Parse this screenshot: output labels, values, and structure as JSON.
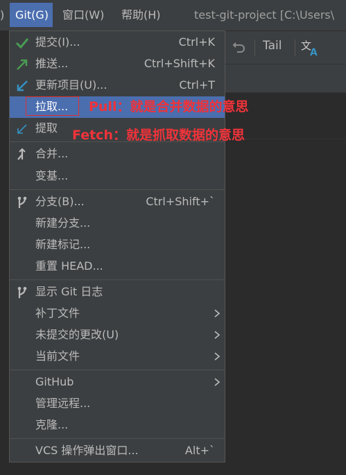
{
  "menubar": {
    "partial_paren": ")",
    "git": "Git(G)",
    "window": "窗口(W)",
    "help": "帮助(H)",
    "window_title": "test-git-project [C:\\Users\\"
  },
  "toolbar": {
    "tail_label": "Tail",
    "undo_icon": "undo-icon",
    "translate_icon": "translate-icon"
  },
  "menu": {
    "commit": {
      "label": "提交(I)...",
      "shortcut": "Ctrl+K",
      "icon": "check-icon",
      "icon_color": "#499c54"
    },
    "push": {
      "label": "推送...",
      "shortcut": "Ctrl+Shift+K",
      "icon": "push-arrow-icon",
      "icon_color": "#499c54"
    },
    "update": {
      "label": "更新项目(U)...",
      "shortcut": "Ctrl+T",
      "icon": "update-arrow-icon",
      "icon_color": "#3592c4"
    },
    "pull": {
      "label": "拉取..."
    },
    "fetch": {
      "label": "提取",
      "icon": "fetch-arrow-icon",
      "icon_color": "#3592c4"
    },
    "merge": {
      "label": "合并...",
      "icon": "merge-icon"
    },
    "rebase": {
      "label": "变基..."
    },
    "branches": {
      "label": "分支(B)...",
      "shortcut": "Ctrl+Shift+`",
      "icon": "branch-icon"
    },
    "new_branch": {
      "label": "新建分支..."
    },
    "new_tag": {
      "label": "新建标记..."
    },
    "reset_head": {
      "label": "重置 HEAD..."
    },
    "show_log": {
      "label": "显示 Git 日志",
      "icon": "git-log-icon"
    },
    "patch": {
      "label": "补丁文件"
    },
    "uncommitted": {
      "label": "未提交的更改(U)"
    },
    "current_file": {
      "label": "当前文件"
    },
    "github": {
      "label": "GitHub"
    },
    "manage_remotes": {
      "label": "管理远程..."
    },
    "clone": {
      "label": "克隆..."
    },
    "vcs_popup": {
      "label": "VCS 操作弹出窗口...",
      "shortcut": "Alt+`"
    }
  },
  "annotations": {
    "pull_note": "Pull：就是合并数据的意思",
    "fetch_note": "Fetch：就是抓取数据的意思",
    "color": "#f0333a"
  },
  "colors": {
    "menu_bg": "#3c3f41",
    "selection": "#4b6eaf",
    "text": "#bbbbbb"
  }
}
